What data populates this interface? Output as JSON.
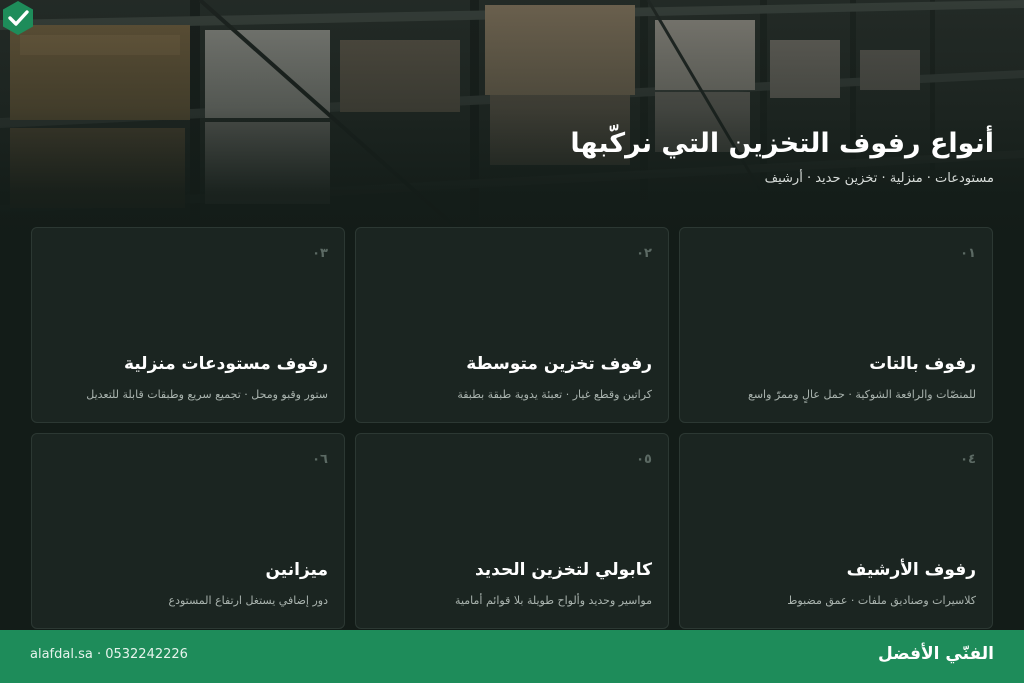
{
  "hero": {
    "title": "أنواع رفوف التخزين التي نركّبها",
    "subtitle": "مستودعات · منزلية · تخزين حديد · أرشيف",
    "logo_icon": "check-shield-icon"
  },
  "cards": [
    {
      "number": "٠١",
      "title": "رفوف بالتات",
      "description": "للمنصّات والرافعة الشوكية · حمل عالٍ وممرّ واسع"
    },
    {
      "number": "٠٢",
      "title": "رفوف تخزين متوسطة",
      "description": "كراتين وقطع غيار · تعبئة يدوية طبقة بطبقة"
    },
    {
      "number": "٠٣",
      "title": "رفوف مستودعات منزلية",
      "description": "ستور وقبو ومحل · تجميع سريع وطبقات قابلة للتعديل"
    },
    {
      "number": "٠٤",
      "title": "رفوف الأرشيف",
      "description": "كلاسيرات وصناديق ملفات · عمق مضبوط"
    },
    {
      "number": "٠٥",
      "title": "كابولي لتخزين الحديد",
      "description": "مواسير وحديد وألواح طويلة بلا قوائم أمامية"
    },
    {
      "number": "٠٦",
      "title": "ميزانين",
      "description": "دور إضافي يستغل ارتفاع المستودع"
    }
  ],
  "footer": {
    "brand": "الفنّي الأفضل",
    "contact": "alafdal.sa · 0532242226"
  },
  "colors": {
    "background": "#131c18",
    "card": "#1b2521",
    "accent": "#1e8c5a",
    "text": "#ffffff",
    "muted": "#aab4af"
  }
}
